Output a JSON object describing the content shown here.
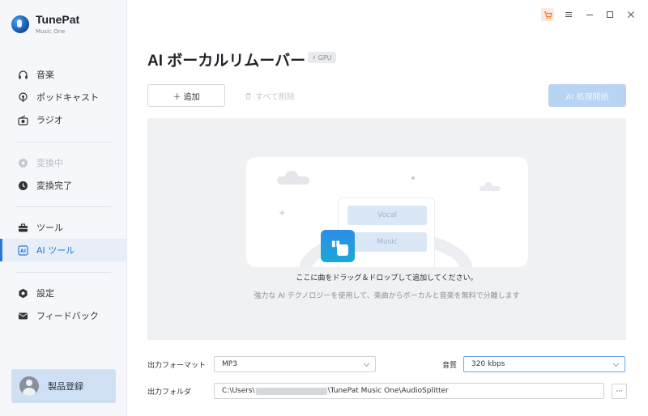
{
  "app": {
    "name": "TunePat",
    "subtitle": "Music One"
  },
  "sidebar": {
    "items": [
      {
        "label": "音楽",
        "icon": "headphones-icon",
        "state": "normal"
      },
      {
        "label": "ポッドキャスト",
        "icon": "podcast-icon",
        "state": "normal"
      },
      {
        "label": "ラジオ",
        "icon": "radio-icon",
        "state": "normal"
      },
      {
        "label": "変換中",
        "icon": "converting-icon",
        "state": "disabled"
      },
      {
        "label": "変換完了",
        "icon": "clock-icon",
        "state": "normal"
      },
      {
        "label": "ツール",
        "icon": "toolbox-icon",
        "state": "normal"
      },
      {
        "label": "AI ツール",
        "icon": "ai-icon",
        "state": "active"
      },
      {
        "label": "設定",
        "icon": "gear-icon",
        "state": "normal"
      },
      {
        "label": "フィードバック",
        "icon": "mail-icon",
        "state": "normal"
      }
    ],
    "register_label": "製品登録"
  },
  "main": {
    "title": "AI ボーカルリムーバー",
    "gpu_badge": "GPU",
    "add_button": "＋ 追加",
    "clear_button": "すべて削除",
    "start_button": "AI 処理開始",
    "dropzone": {
      "vocal_label": "Vocal",
      "music_label": "Music",
      "main_text": "ここに曲をドラッグ＆ドロップして追加してください。",
      "sub_text": "強力な AI テクノロジーを使用して、楽曲からボーカルと音楽を無料で分離します"
    },
    "output_format_label": "出力フォーマット",
    "output_format_value": "MP3",
    "quality_label": "音質",
    "quality_value": "320 kbps",
    "output_folder_label": "出力フォルダ",
    "output_folder_prefix": "C:\\Users\\",
    "output_folder_suffix": "\\TunePat Music One\\AudioSplitter",
    "browse_label": "···"
  },
  "colors": {
    "accent": "#2a78d4",
    "start_button_bg": "#b8d4f3",
    "sidebar_bg": "#f5f7fa",
    "dropzone_bg": "#f0f1f3"
  }
}
